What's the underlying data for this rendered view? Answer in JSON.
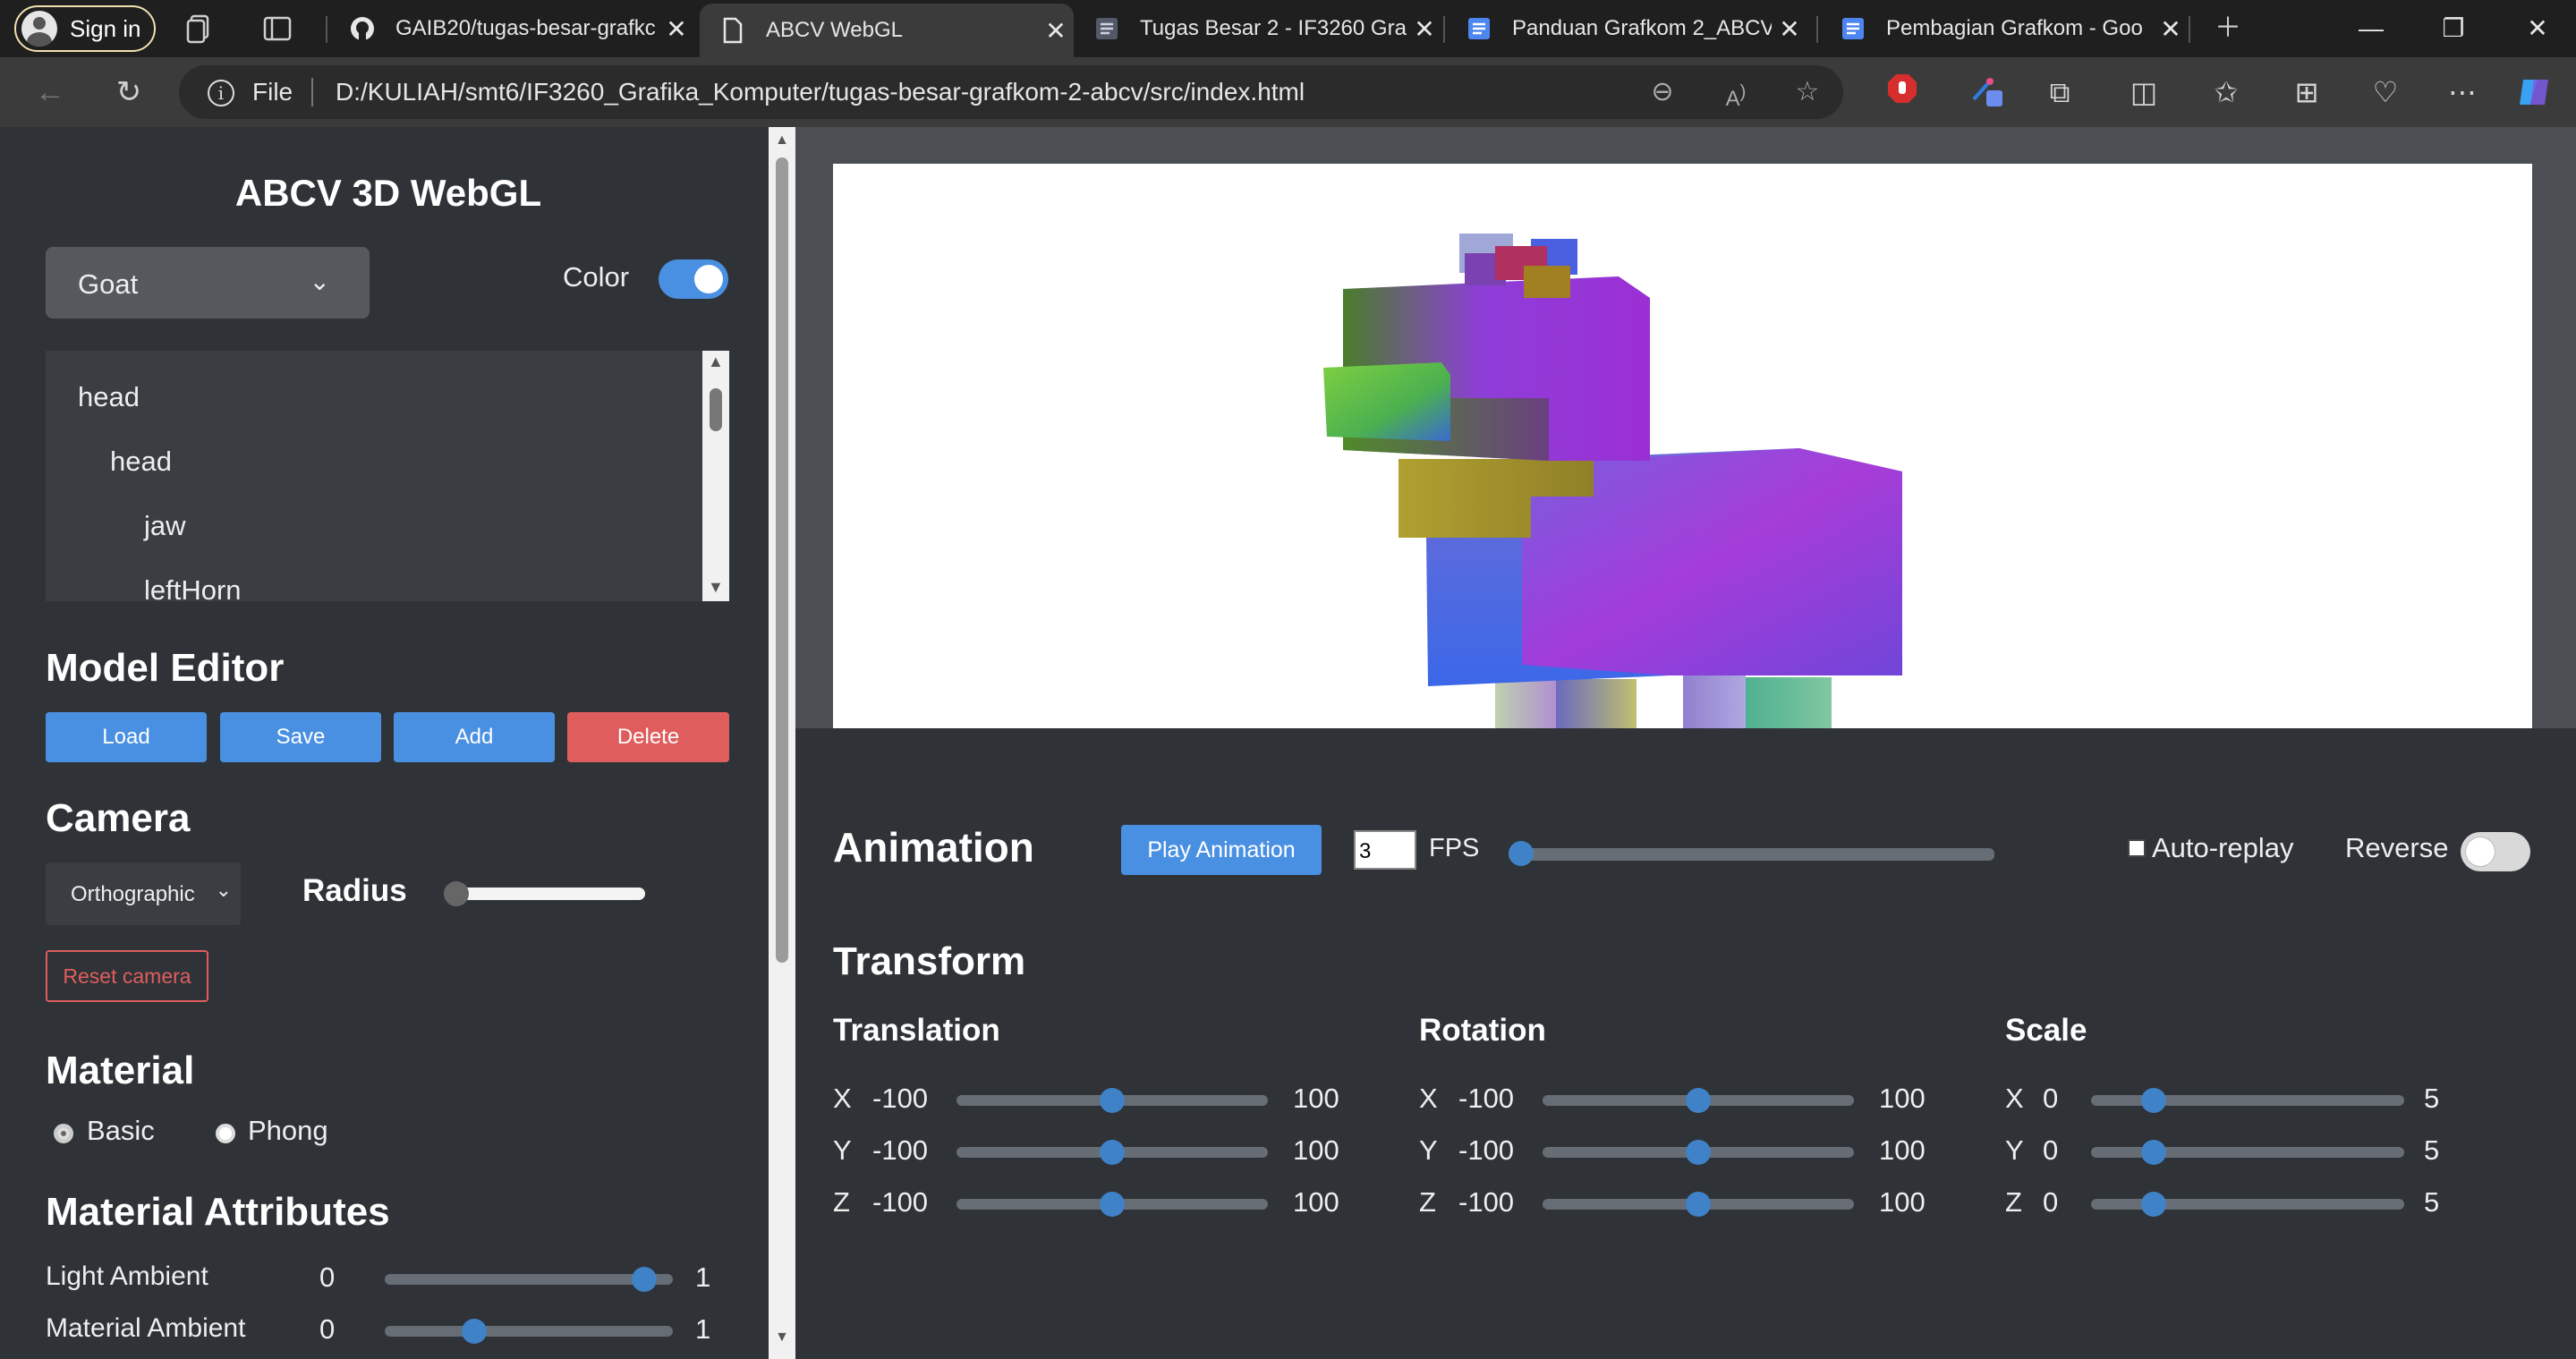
{
  "browser": {
    "signin_label": "Sign in",
    "tabs": [
      {
        "title": "GAIB20/tugas-besar-grafkc",
        "icon": "github-icon"
      },
      {
        "title": "ABCV WebGL",
        "icon": "file-icon"
      },
      {
        "title": "Tugas Besar 2 - IF3260 Gra",
        "icon": "doc-icon"
      },
      {
        "title": "Panduan Grafkom 2_ABCV",
        "icon": "doc-icon"
      },
      {
        "title": "Pembagian Grafkom - Goo",
        "icon": "doc-icon"
      }
    ],
    "address_prefix": "File",
    "url": "D:/KULIAH/smt6/IF3260_Grafika_Komputer/tugas-besar-grafkom-2-abcv/src/index.html"
  },
  "sidebar": {
    "title": "ABCV 3D WebGL",
    "model_select": "Goat",
    "color_label": "Color",
    "color_on": true,
    "tree": [
      "head",
      "head",
      "jaw",
      "leftHorn"
    ],
    "model_editor": {
      "title": "Model Editor",
      "load": "Load",
      "save": "Save",
      "add": "Add",
      "delete": "Delete"
    },
    "camera": {
      "title": "Camera",
      "projection": "Orthographic",
      "radius_label": "Radius",
      "radius_level": 0.03,
      "reset": "Reset camera"
    },
    "material": {
      "title": "Material",
      "options": [
        "Basic",
        "Phong"
      ],
      "selected": "Basic"
    },
    "material_attributes": {
      "title": "Material Attributes",
      "rows": [
        {
          "label": "Light Ambient",
          "min": "0",
          "max": "1",
          "value": 0.9
        },
        {
          "label": "Material Ambient",
          "min": "0",
          "max": "1",
          "value": 0.31
        }
      ]
    }
  },
  "animation": {
    "title": "Animation",
    "play": "Play Animation",
    "fps_value": "3",
    "fps_label": "FPS",
    "fps_level": 0.0,
    "autoreplay": "Auto-replay",
    "reverse": "Reverse",
    "reverse_on": false
  },
  "transform": {
    "title": "Transform",
    "groups": [
      {
        "title": "Translation",
        "rows": [
          {
            "axis": "X",
            "min": "-100",
            "max": "100",
            "value": 0
          },
          {
            "axis": "Y",
            "min": "-100",
            "max": "100",
            "value": 0
          },
          {
            "axis": "Z",
            "min": "-100",
            "max": "100",
            "value": 0
          }
        ]
      },
      {
        "title": "Rotation",
        "rows": [
          {
            "axis": "X",
            "min": "-100",
            "max": "100",
            "value": 0
          },
          {
            "axis": "Y",
            "min": "-100",
            "max": "100",
            "value": 0
          },
          {
            "axis": "Z",
            "min": "-100",
            "max": "100",
            "value": 0
          }
        ]
      },
      {
        "title": "Scale",
        "rows": [
          {
            "axis": "X",
            "min": "0",
            "max": "5",
            "value": 1
          },
          {
            "axis": "Y",
            "min": "0",
            "max": "5",
            "value": 1
          },
          {
            "axis": "Z",
            "min": "0",
            "max": "5",
            "value": 1
          }
        ]
      }
    ]
  },
  "colors": {
    "accent": "#4a90e2",
    "danger": "#e05d5d",
    "panel": "#2f3337"
  }
}
